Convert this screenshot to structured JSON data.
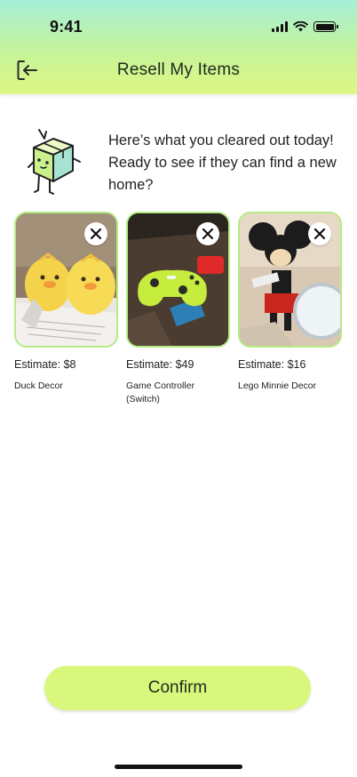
{
  "status_bar": {
    "time": "9:41",
    "icons": [
      "cellular-signal-icon",
      "wifi-icon",
      "battery-icon"
    ]
  },
  "header": {
    "back_icon": "exit-icon",
    "title": "Resell My Items"
  },
  "intro": {
    "mascot": "box-mascot-illustration",
    "message": "Here’s what you cleared out today! Ready to see if they can find a new home?"
  },
  "items": [
    {
      "estimate": "Estimate: $8",
      "name": "Duck Decor",
      "remove_icon": "close-icon"
    },
    {
      "estimate": "Estimate: $49",
      "name": "Game Controller (Switch)",
      "remove_icon": "close-icon"
    },
    {
      "estimate": "Estimate: $16",
      "name": "Lego Minnie Decor",
      "remove_icon": "close-icon"
    }
  ],
  "confirm_label": "Confirm",
  "colors": {
    "accent": "#d9f77c",
    "card_border": "#b4ec86",
    "header_top": "#a6efd8",
    "header_bottom": "#dcf784"
  }
}
